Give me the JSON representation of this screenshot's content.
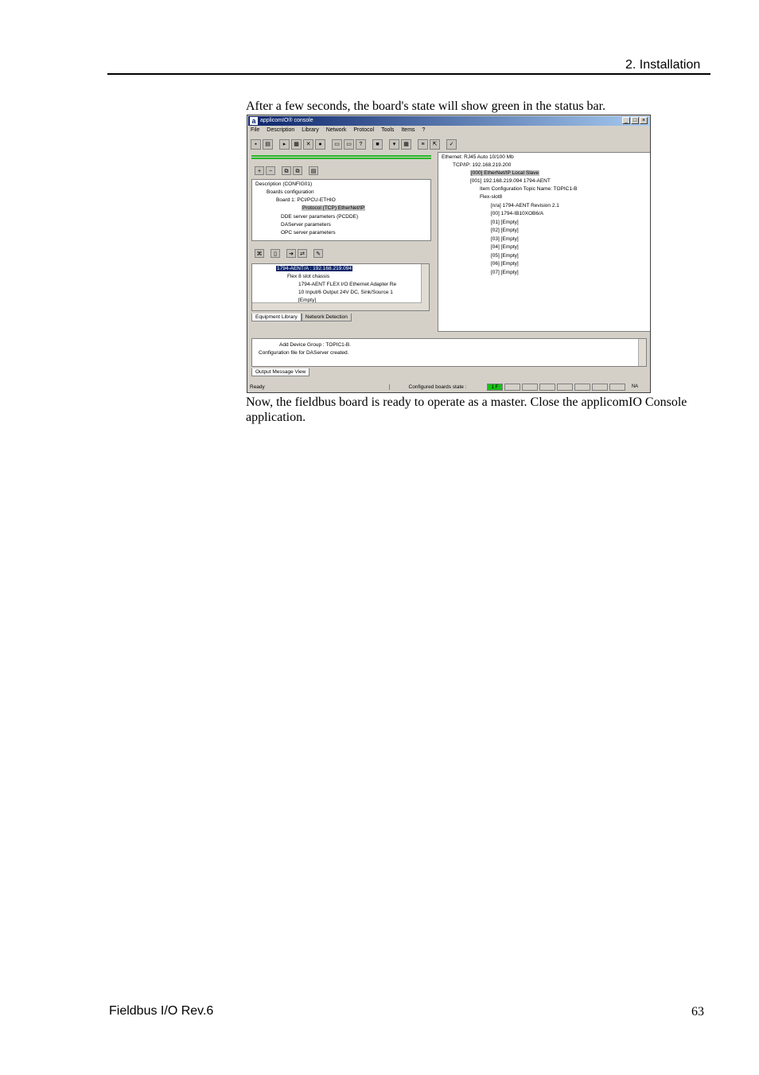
{
  "header": {
    "section": "2. Installation"
  },
  "body": {
    "intro": "After a few seconds, the board's state will show green in the status bar.",
    "outro": "Now, the fieldbus board is ready to operate as a master.  Close the applicomIO Console application."
  },
  "footer": {
    "doc_title": "Fieldbus I/O Rev.6",
    "page_number": "63"
  },
  "screenshot": {
    "title": "applicomIO® console",
    "menu": [
      "File",
      "Description",
      "Library",
      "Network",
      "Protocol",
      "Tools",
      "Items",
      "?"
    ],
    "left_tree": [
      "Description (CONFIG01)",
      "Boards configuration",
      "Board 1:    PCI/PCU-ETHIO",
      "Protocol (TCP) EtherNet/IP",
      "DDE server parameters (PCDDE)",
      "DAServer parameters",
      "OPC server parameters"
    ],
    "equipment_tree": [
      "1794-AENT/A : 192.168.219.094",
      "Flex 8 slot chassis",
      "1794-AENT FLEX I/O Ethernet Adapter Re",
      "10 Input/6 Output 24V DC, Sink/Source 1",
      "[Empty]"
    ],
    "tabs": [
      "Equipment Library",
      "Network Detection"
    ],
    "right_tree": [
      "Ethernet: RJ45 Auto 10/100 Mb",
      "TCP/IP: 192.168.219.200",
      "[000] EtherNet/IP Local Slave",
      "[001] 192.168.219.094    1794-AENT",
      "Item Configuration   Topic Name: TOPIC1-B",
      "Flex-slot8",
      "[n/a] 1794-AENT Revision 2.1",
      "[00] 1794-IB10XOB6/A",
      "[01] [Empty]",
      "[02] [Empty]",
      "[03] [Empty]",
      "[04] [Empty]",
      "[05] [Empty]",
      "[06] [Empty]",
      "[07] [Empty]"
    ],
    "output_messages": [
      "Add Device Group : TOPIC1-B.",
      "Configuration file for DAServer created."
    ],
    "output_tab": "Output Message View",
    "status": {
      "ready": "Ready",
      "configured": "Configured boards state :",
      "board_cell": "1 F",
      "mode": "NA"
    },
    "colors": {
      "board_ok": "#18c018",
      "titlebar": "#0a246a"
    }
  }
}
